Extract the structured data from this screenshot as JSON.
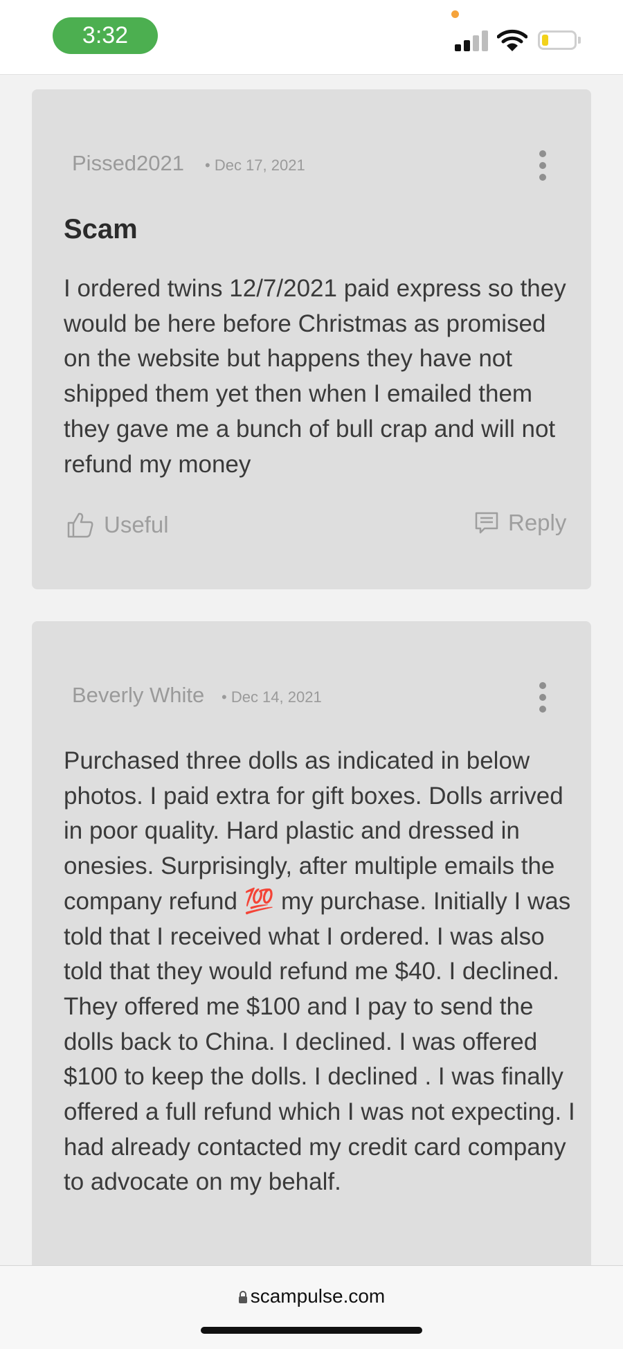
{
  "status_bar": {
    "time": "3:32",
    "icons": [
      "signal-icon",
      "wifi-icon",
      "battery-icon"
    ],
    "time_pill_color": "#4caf50",
    "battery_level": 0.2
  },
  "reviews": [
    {
      "reviewer": "Pissed2021",
      "date": "• Dec 17, 2021",
      "title": "Scam",
      "body": "I ordered twins 12/7/2021 paid express so they would be here before Christmas as promised on the website but happens they have not shipped them yet then when I emailed them they gave me a bunch of bull crap and will not refund my money",
      "useful_label": "Useful",
      "reply_label": "Reply"
    },
    {
      "reviewer": "Beverly White",
      "date": "• Dec 14, 2021",
      "body": "Purchased three dolls as indicated in below photos. I paid extra for gift boxes. Dolls arrived in poor quality. Hard plastic and dressed in onesies. Surprisingly, after multiple emails the company refund 💯 my purchase. Initially I was told that I received what I ordered. I was also told that they would refund me $40. I declined. They offered me $100 and I pay to send the dolls back to China. I declined. I was offered $100 to keep the dolls. I declined . I was finally offered a full refund which I was not expecting. I had already contacted my credit card company to advocate on my behalf."
    }
  ],
  "browser": {
    "url": "scampulse.com"
  }
}
